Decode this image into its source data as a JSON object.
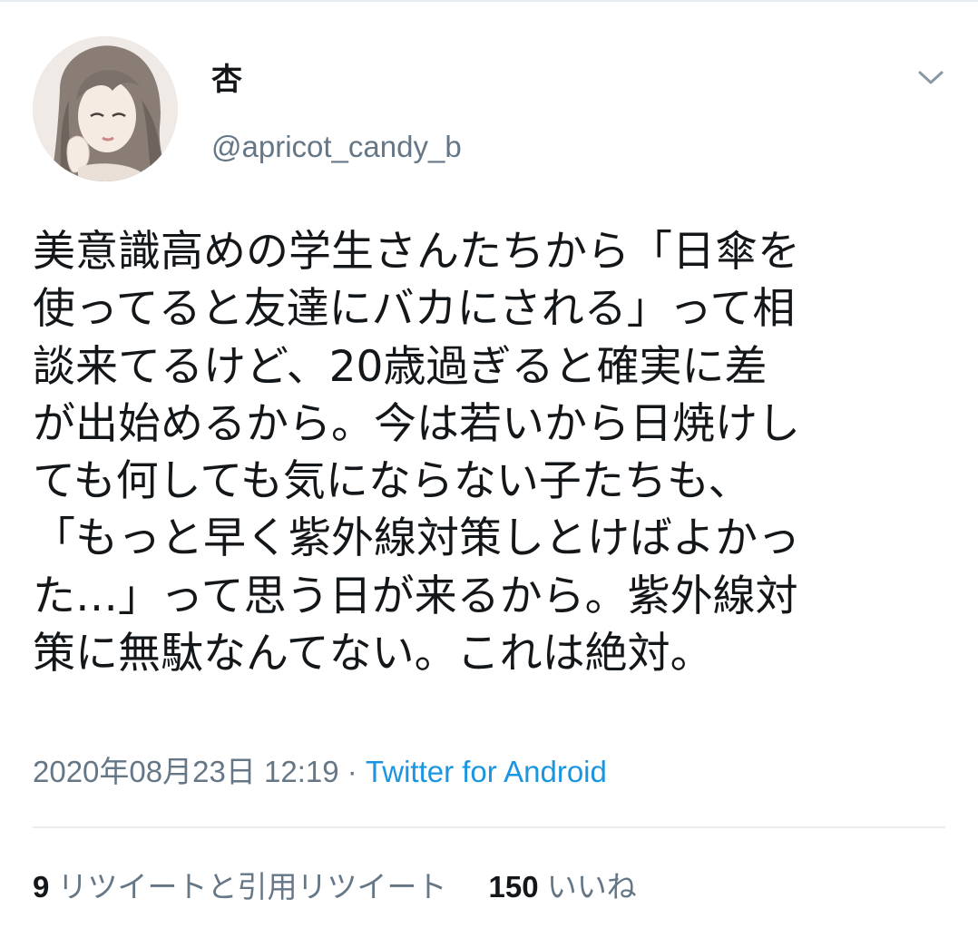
{
  "user": {
    "display_name": "杏",
    "handle": "@apricot_candy_b",
    "avatar_icon": "avatar-illustration-icon"
  },
  "tweet": {
    "lines": [
      "美意識高めの学生さんたちから「日傘を",
      "使ってると友達にバカにされる」って相",
      "談来てるけど、20歳過ぎると確実に差",
      "が出始めるから。今は若いから日焼けし",
      "ても何しても気にならない子たちも、",
      "「もっと早く紫外線対策しとけばよかっ",
      "た…」って思う日が来るから。紫外線対",
      "策に無駄なんてない。これは絶対。"
    ],
    "date": "2020年08月23日 12:19",
    "separator": " · ",
    "source": "Twitter for Android"
  },
  "stats": {
    "retweet_count": "9",
    "retweet_label": "リツイートと引用リツイート",
    "like_count": "150",
    "like_label": "いいね"
  },
  "icons": {
    "menu": "chevron-down-icon"
  },
  "colors": {
    "text": "#14171a",
    "secondary": "#657786",
    "link": "#1b95e0",
    "divider": "#e6ecf0"
  }
}
